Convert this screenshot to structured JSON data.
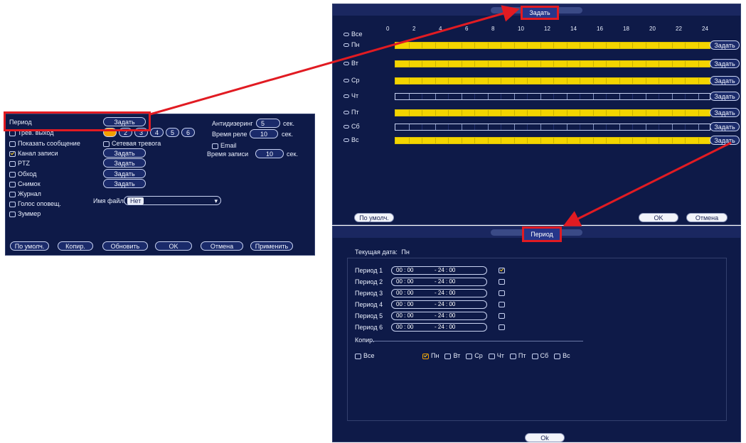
{
  "left_panel": {
    "rows": [
      {
        "label": "Период",
        "button": "Задать"
      },
      {
        "label": "Трев. выход",
        "outputs": [
          "1",
          "2",
          "3",
          "4",
          "5",
          "6"
        ]
      },
      {
        "label": "Показать сообщение",
        "extra_checkbox": "Сетевая тревога"
      },
      {
        "label": "Канал записи",
        "button": "Задать",
        "checked": true
      },
      {
        "label": "PTZ",
        "button": "Задать"
      },
      {
        "label": "Обход",
        "button": "Задать"
      },
      {
        "label": "Снимок",
        "button": "Задать"
      },
      {
        "label": "Журнал"
      },
      {
        "label": "Голос оповещ."
      },
      {
        "label": "Зуммер"
      }
    ],
    "antidither_label": "Антидизеринг",
    "antidither_value": "5",
    "antidither_unit": "сек.",
    "relay_time_label": "Время реле",
    "relay_time_value": "10",
    "relay_time_unit": "сек.",
    "email_label": "Email",
    "record_time_label": "Время записи",
    "record_time_value": "10",
    "record_time_unit": "сек.",
    "filename_label": "Имя файла",
    "filename_value": "Нет",
    "buttons": [
      "По умолч.",
      "Копир.",
      "Обновить",
      "OK",
      "Отмена",
      "Применить"
    ]
  },
  "schedule_panel": {
    "title": "Задать",
    "all_label": "Все",
    "ticks": [
      "0",
      "2",
      "4",
      "6",
      "8",
      "10",
      "12",
      "14",
      "16",
      "18",
      "20",
      "22",
      "24"
    ],
    "days": [
      {
        "label": "Пн",
        "filled": true
      },
      {
        "label": "Вт",
        "filled": true
      },
      {
        "label": "Ср",
        "filled": true
      },
      {
        "label": "Чт",
        "filled": false
      },
      {
        "label": "Пт",
        "filled": true
      },
      {
        "label": "Сб",
        "filled": false
      },
      {
        "label": "Вс",
        "filled": true
      }
    ],
    "set_button": "Задать",
    "default_button": "По умолч.",
    "ok_button": "OK",
    "cancel_button": "Отмена"
  },
  "period_panel": {
    "title": "Период",
    "current_date_label": "Текущая дата:",
    "current_date_value": "Пн",
    "periods": [
      {
        "label": "Период 1",
        "start": "00 : 00",
        "end": "- 24 : 00",
        "checked": true
      },
      {
        "label": "Период 2",
        "start": "00 : 00",
        "end": "- 24 : 00",
        "checked": false
      },
      {
        "label": "Период 3",
        "start": "00 : 00",
        "end": "- 24 : 00",
        "checked": false
      },
      {
        "label": "Период 4",
        "start": "00 : 00",
        "end": "- 24 : 00",
        "checked": false
      },
      {
        "label": "Период 5",
        "start": "00 : 00",
        "end": "- 24 : 00",
        "checked": false
      },
      {
        "label": "Период 6",
        "start": "00 : 00",
        "end": "- 24 : 00",
        "checked": false
      }
    ],
    "copy_label": "Копир.",
    "copy_all_label": "Все",
    "copy_days": [
      {
        "label": "Пн",
        "checked": true
      },
      {
        "label": "Вт",
        "checked": false
      },
      {
        "label": "Ср",
        "checked": false
      },
      {
        "label": "Чт",
        "checked": false
      },
      {
        "label": "Пт",
        "checked": false
      },
      {
        "label": "Сб",
        "checked": false
      },
      {
        "label": "Вс",
        "checked": false
      }
    ],
    "ok_button": "Ok"
  },
  "colors": {
    "panel_bg": "#0e1a48",
    "highlight": "#e11b22",
    "bar": "#f3d500"
  }
}
